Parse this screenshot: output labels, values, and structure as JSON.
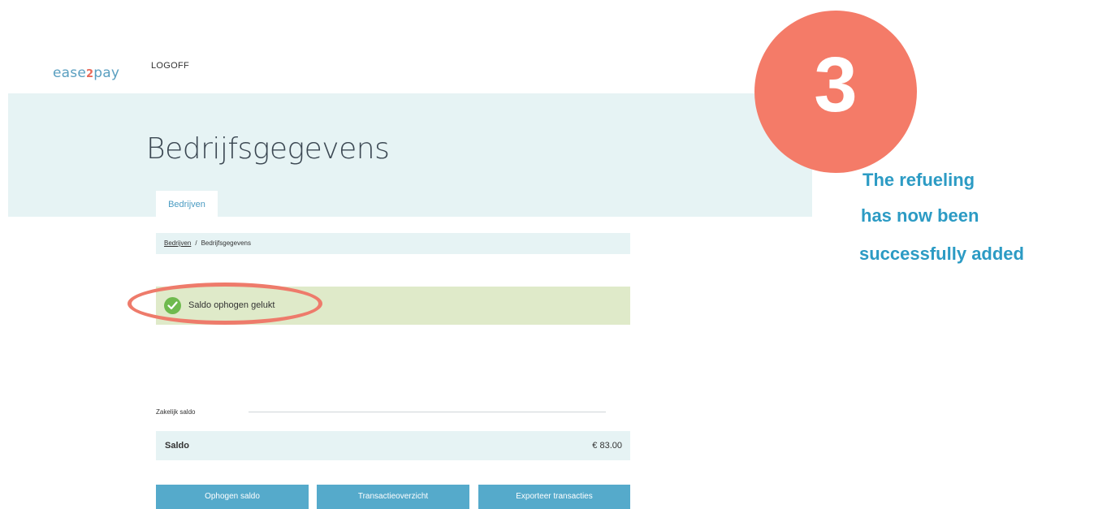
{
  "header": {
    "logo_part1": "ease",
    "logo_part2": "2",
    "logo_part3": "pay",
    "logoff_label": "LOGOFF"
  },
  "page": {
    "title": "Bedrijfsgegevens",
    "tab_label": "Bedrijven"
  },
  "breadcrumb": {
    "link": "Bedrijven",
    "separator": "/",
    "current": "Bedrijfsgegevens"
  },
  "alert": {
    "message": "Saldo ophogen gelukt"
  },
  "balance": {
    "section_label": "Zakelijk saldo",
    "label": "Saldo",
    "value": "€ 83.00"
  },
  "actions": {
    "increase": "Ophogen saldo",
    "transactions": "Transactieoverzicht",
    "export": "Exporteer transacties"
  },
  "annotation": {
    "step_number": "3",
    "line1": "The refueling",
    "line2": "has now been",
    "line3": "successfully added"
  },
  "colors": {
    "accent": "#55aacb",
    "hero_bg": "#e6f3f4",
    "success_bg": "#dfeac9",
    "success_icon": "#6fba4e",
    "annotation_red": "#f47b68",
    "annotation_text": "#2c9bc4"
  }
}
